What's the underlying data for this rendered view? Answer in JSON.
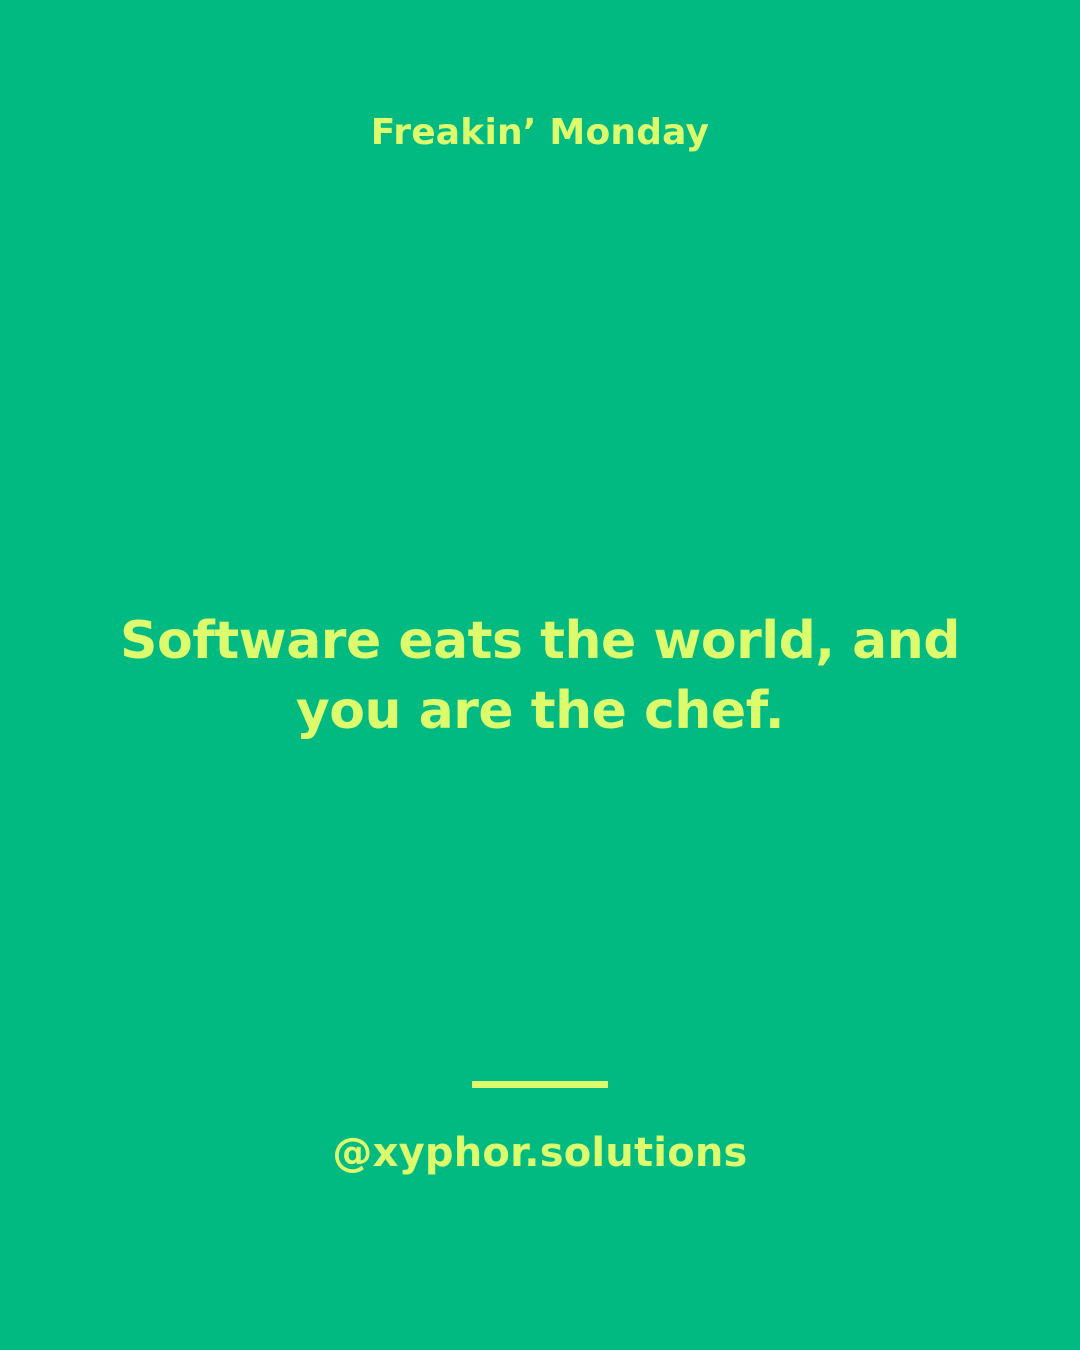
{
  "post": {
    "series_title": "Freakin’ Monday",
    "quote": "Software eats the world, and you are the chef.",
    "handle": "@xyphor.solutions"
  },
  "colors": {
    "background": "#00BA82",
    "text": "#DCFC6E"
  }
}
